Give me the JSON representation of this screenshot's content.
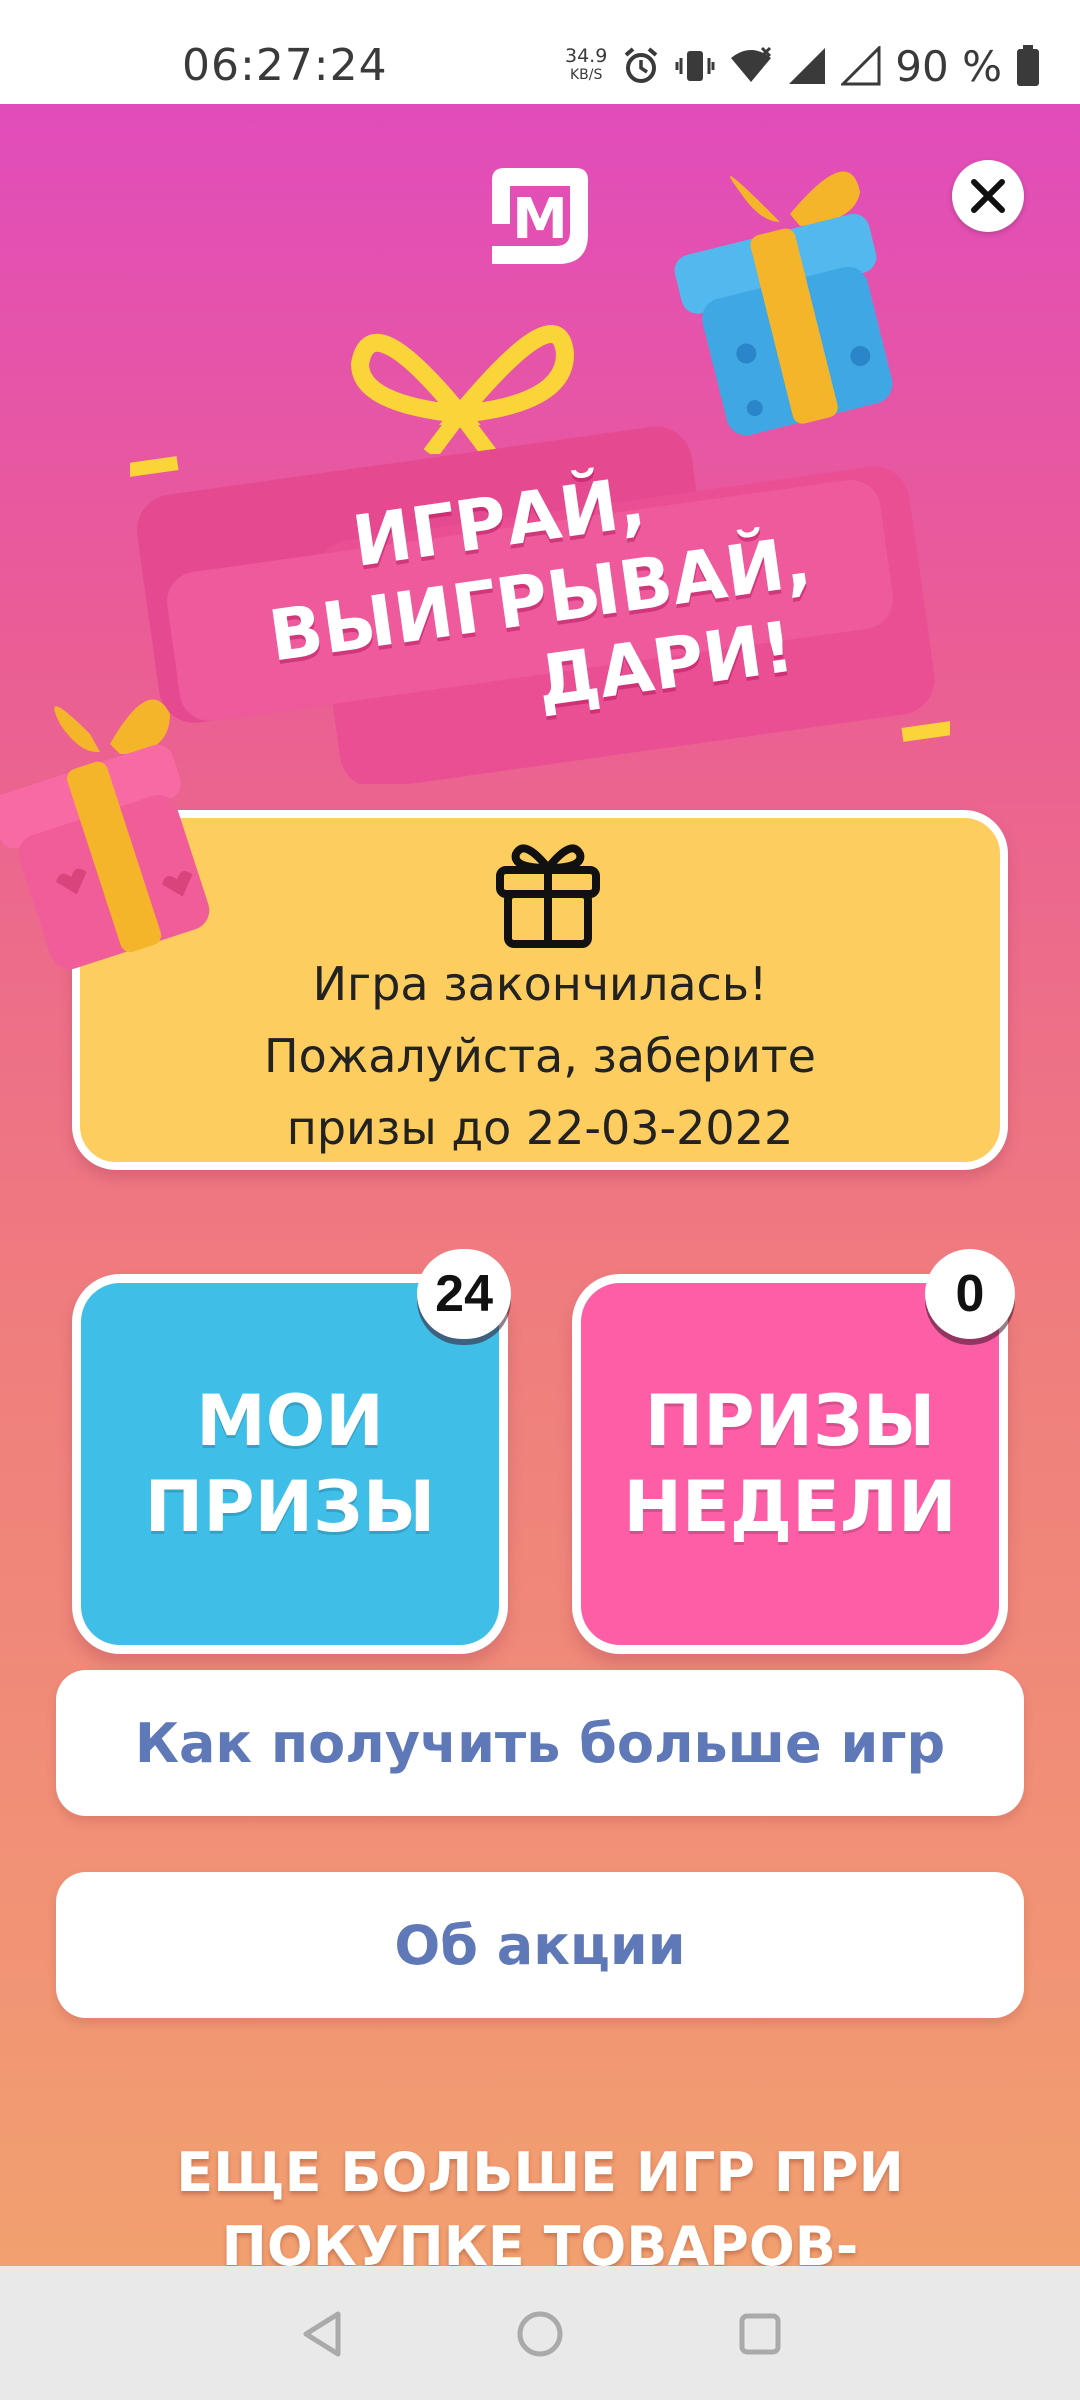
{
  "status_bar": {
    "time": "06:27:24",
    "net_speed": "34.9",
    "net_speed_unit": "KB/S",
    "battery_text": "90 %",
    "icons": [
      "alarm-icon",
      "vibrate-icon",
      "wifi-icon",
      "signal-icon",
      "signal-icon-2",
      "battery-icon"
    ]
  },
  "promo": {
    "logo_letter": "М",
    "banner_lines": [
      "ИГРАЙ,",
      "ВЫИГРЫВАЙ,",
      "ДАРИ!"
    ],
    "info_lines": [
      "Игра закончилась!",
      "Пожалуйста, заберите",
      "призы до 22-03-2022"
    ],
    "my_prizes": {
      "line1": "МОИ",
      "line2": "ПРИЗЫ",
      "count": "24",
      "color": "#3fbfe8"
    },
    "week_prizes": {
      "line1": "ПРИЗЫ",
      "line2": "НЕДЕЛИ",
      "count": "0",
      "color": "#fd5ea6"
    },
    "more_games_label": "Как получить больше игр",
    "about_label": "Об акции",
    "bottom_lines": [
      "ЕЩЕ БОЛЬШЕ ИГР ПРИ",
      "ПОКУПКЕ ТОВАРОВ-"
    ]
  },
  "colors": {
    "gradient_top": "#e14cbb",
    "gradient_bottom": "#f2a070",
    "info_card": "#fdcd5f",
    "button_text": "#5f78b8"
  }
}
